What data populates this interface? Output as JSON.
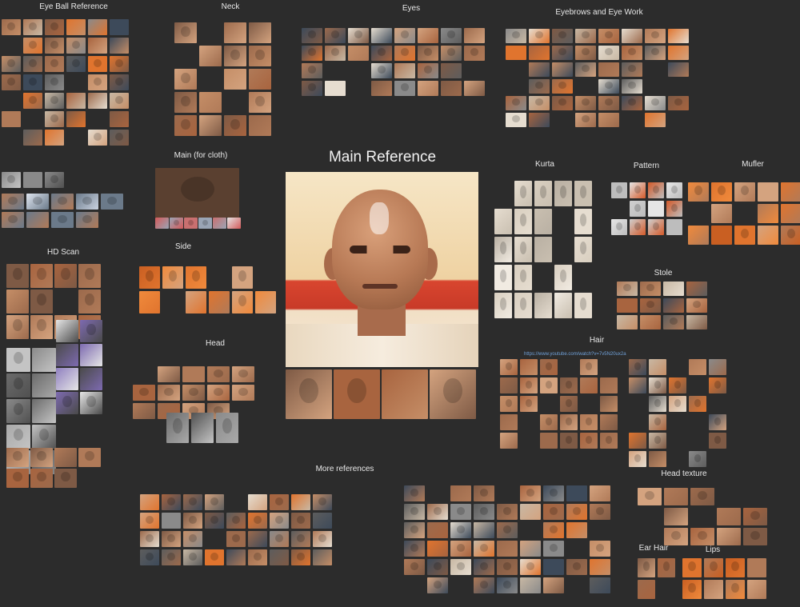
{
  "board": {
    "background": "#2c2c2c"
  },
  "labels": {
    "eyeball": "Eye Ball Reference",
    "neck": "Neck",
    "eyes": "Eyes",
    "eyebrows": "Eyebrows and Eye Work",
    "main_cloth": "Main (for cloth)",
    "main_reference": "Main Reference",
    "kurta": "Kurta",
    "pattern": "Pattern",
    "mufler": "Mufler",
    "hd_scan": "HD Scan",
    "side": "Side",
    "stole": "Stole",
    "head": "Head",
    "hair": "Hair",
    "more_references": "More references",
    "head_texture": "Head texture",
    "ear_hair": "Ear Hair",
    "lips": "Lips"
  },
  "hair_url": "https://www.youtube.com/watch?v=7v5N20ux2a",
  "palette": {
    "skin": "#b07a58",
    "saffron": "#e0742e",
    "cloth": "#e6ddd0",
    "gray": "#8a8a8a"
  }
}
